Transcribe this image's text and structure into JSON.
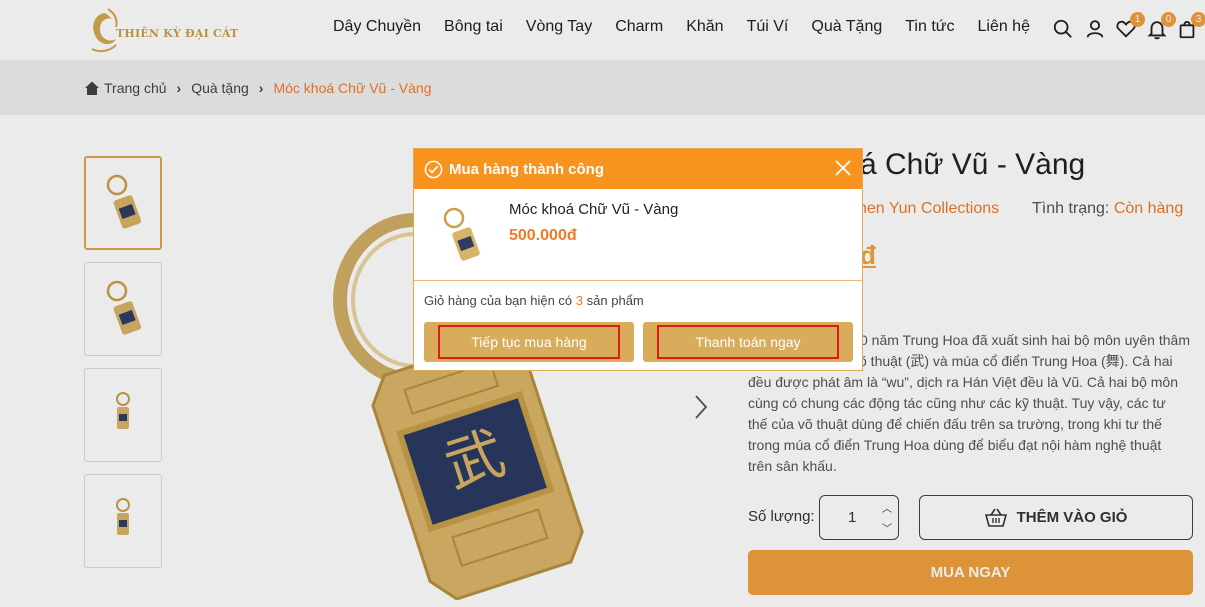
{
  "header": {
    "logo_text": "THIÊN KỲ ĐẠI CÁT",
    "nav": [
      "Dây Chuyền",
      "Bông tai",
      "Vòng Tay",
      "Charm",
      "Khăn",
      "Túi Ví",
      "Quà Tặng",
      "Tin tức",
      "Liên hệ"
    ],
    "badges": {
      "wishlist": "1",
      "notifications": "0",
      "cart": "3"
    }
  },
  "breadcrumb": {
    "home": "Trang chủ",
    "category": "Quà tặng",
    "current": "Móc khoá Chữ Vũ - Vàng"
  },
  "product": {
    "title_visible": "á Chữ Vũ - Vàng",
    "brand_visible": "hen Yun Collections",
    "stock_label": "Tình trạng:",
    "stock_value": "Còn hàng",
    "price_visible": "đ",
    "description_lines": [
      "0 năm Trung Hoa đã xuất sinh hai bộ môn uyên thâm",
      "võ thuật (武) và múa cổ điển Trung Hoa (舞). Cả hai",
      "đều được phát âm là “wu”, dịch ra Hán Việt đều là Vũ. Cả hai bộ môn",
      "cùng có chung các động tác cũng như các kỹ thuật. Tuy vậy, các tư",
      "thế của võ thuật dùng để chiến đấu trên sa trường, trong khi tư thế",
      "trong múa cổ điển Trung Hoa dùng để biểu đạt nội hàm nghệ thuật",
      "trên sân khấu."
    ],
    "qty_label": "Số lượng:",
    "qty_value": "1",
    "add_to_cart": "THÊM VÀO GIỎ",
    "buy_now": "MUA NGAY"
  },
  "modal": {
    "title": "Mua hàng thành công",
    "item_name": "Móc khoá Chữ Vũ - Vàng",
    "item_price": "500.000đ",
    "cart_text_before": "Giỏ hàng của bạn hiện có",
    "cart_count": "3",
    "cart_text_after": "sản phẩm",
    "continue_button": "Tiếp tục mua hàng",
    "checkout_button": "Thanh toán ngay"
  },
  "colors": {
    "accent": "#f7931e",
    "gold": "#d9ac5c",
    "link_orange": "#f07a2a",
    "highlight_border": "#e01b1b"
  }
}
